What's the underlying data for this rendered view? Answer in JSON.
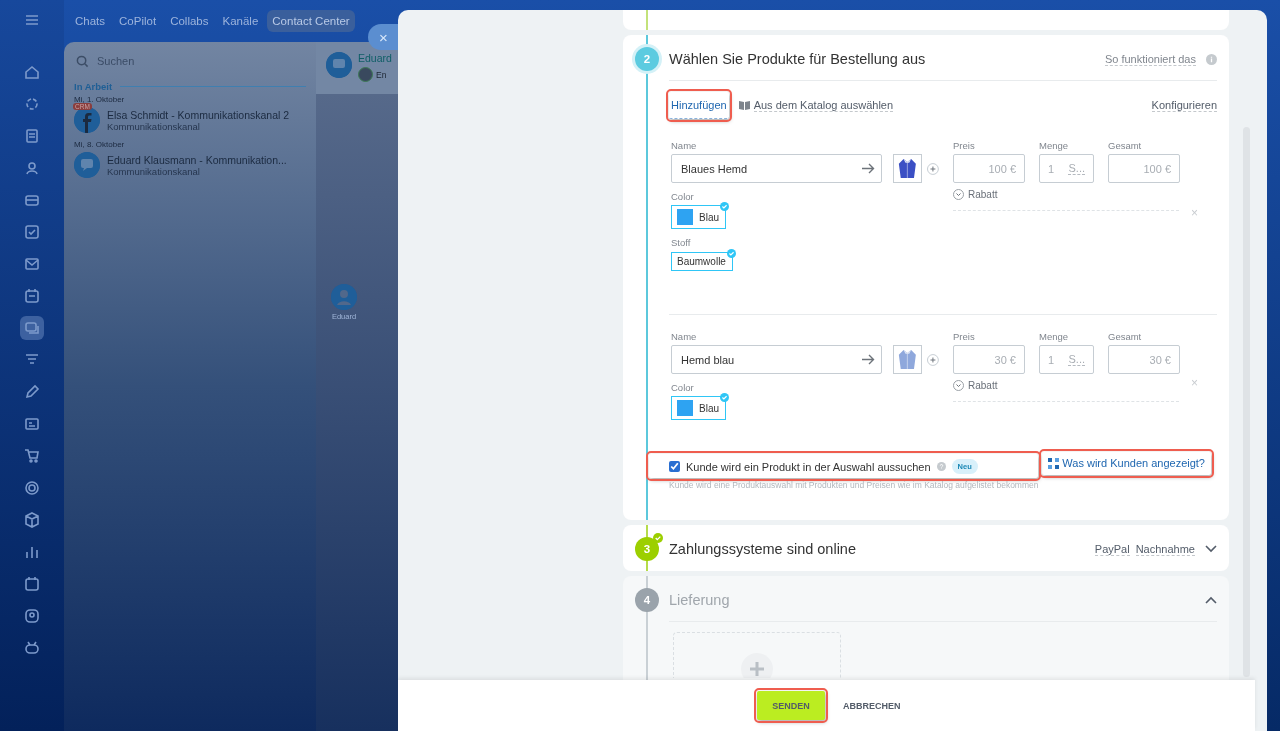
{
  "app": {
    "nav_tabs": [
      {
        "label": "Chats",
        "selected": false
      },
      {
        "label": "CoPilot",
        "selected": false
      },
      {
        "label": "Collabs",
        "selected": false
      },
      {
        "label": "Kanäle",
        "selected": false
      },
      {
        "label": "Contact Center",
        "selected": true
      }
    ],
    "search": {
      "placeholder": "Suchen"
    },
    "group_title": "In Arbeit",
    "chat_days": [
      {
        "date": "Mi, 1. Oktober",
        "chats": [
          {
            "kind": "facebook",
            "badge": "CRM",
            "title": "Elsa Schmidt - Kommunikationskanal 2",
            "subtitle": "Kommunikationskanal"
          }
        ]
      },
      {
        "date": "Mi, 8. Oktober",
        "chats": [
          {
            "kind": "message",
            "title": "Eduard Klausmann - Kommunikation...",
            "subtitle": "Kommunikationskanal"
          }
        ]
      }
    ],
    "chat_header": {
      "name": "Eduard",
      "status": "En"
    },
    "participant": "Eduard"
  },
  "close_label": "×",
  "order_step": {
    "number": "2",
    "title": "Wählen Sie Produkte für Bestellung aus",
    "help": "So funktioniert das",
    "actions": {
      "add": {
        "label": "Hinzufügen",
        "highlighted": true
      },
      "catalog": "Aus dem Katalog auswählen",
      "configure": "Konfigurieren"
    },
    "products": [
      {
        "name_label": "Name",
        "name": "Blaues Hemd",
        "price_label": "Preis",
        "price": "100 €",
        "quantity_label": "Menge",
        "quantity": "1",
        "unit": "S...",
        "total_label": "Gesamt",
        "total": "100 €",
        "discount": "Rabatt",
        "remove": "×",
        "properties": [
          {
            "kind": "color",
            "label": "Color",
            "value": "Blau"
          },
          {
            "kind": "text",
            "label": "Stoff",
            "value": "Baumwolle"
          }
        ]
      },
      {
        "name_label": "Name",
        "name": "Hemd blau",
        "price_label": "Preis",
        "price": "30 €",
        "quantity_label": "Menge",
        "quantity": "1",
        "unit": "S...",
        "total_label": "Gesamt",
        "total": "30 €",
        "discount": "Rabatt",
        "remove": "×",
        "properties": [
          {
            "kind": "color",
            "label": "Color",
            "value": "Blau"
          }
        ]
      }
    ],
    "option": {
      "label": "Kunde wird ein Produkt in der Auswahl aussuchen",
      "checked": true,
      "badge": "Neu",
      "hint": "Kunde wird eine Produktauswahl mit Produkten und Preisen wie im Katalog aufgelistet bekommen",
      "highlighted": true
    },
    "preview": {
      "label": "Was wird Kunden angezeigt?",
      "highlighted": true
    }
  },
  "payment_step": {
    "number": "3",
    "title": "Zahlungssysteme sind online",
    "done": true,
    "expanded": false,
    "methods": [
      "PayPal",
      "Nachnahme"
    ]
  },
  "delivery_step": {
    "number": "4",
    "title": "Lieferung",
    "expanded": true
  },
  "footer": {
    "send": {
      "label": "SENDEN",
      "highlighted": true
    },
    "cancel": "ABBRECHEN"
  }
}
